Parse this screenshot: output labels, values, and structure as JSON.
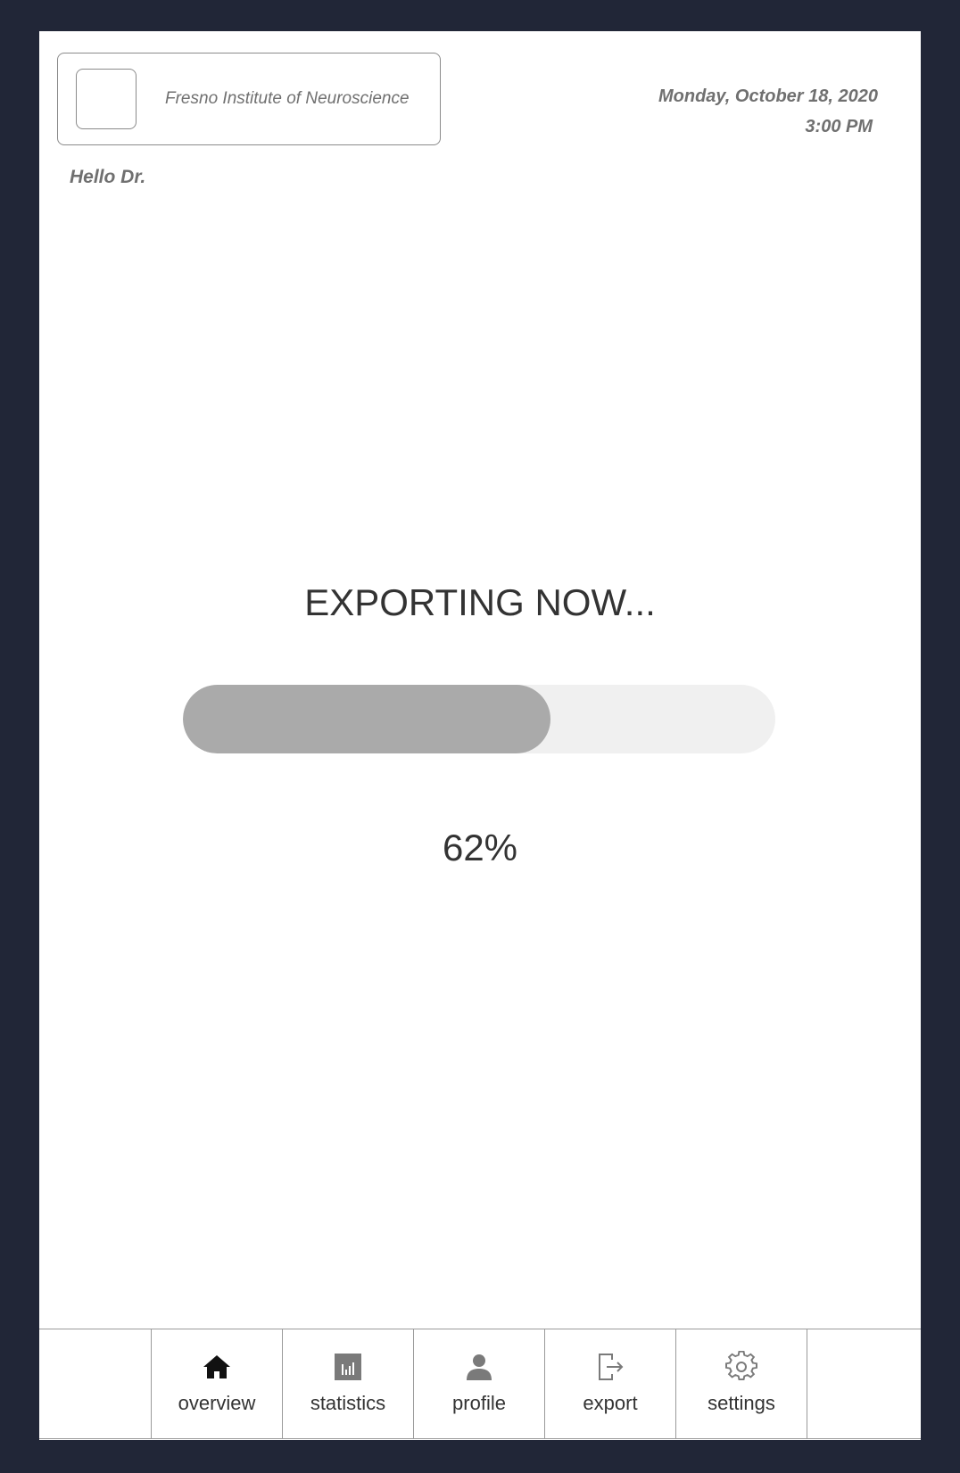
{
  "header": {
    "institution_name": "Fresno Institute of Neuroscience",
    "date": "Monday, October 18, 2020",
    "time": "3:00 PM",
    "greeting": "Hello Dr."
  },
  "export_status": {
    "title": "EXPORTING NOW...",
    "progress": 0.62,
    "percent_label": "62%"
  },
  "nav": {
    "items": [
      {
        "label": "overview",
        "icon": "home-icon"
      },
      {
        "label": "statistics",
        "icon": "bar-chart-icon"
      },
      {
        "label": "profile",
        "icon": "user-icon"
      },
      {
        "label": "export",
        "icon": "export-icon"
      },
      {
        "label": "settings",
        "icon": "gear-icon"
      }
    ]
  },
  "colors": {
    "frame": "#212637",
    "progress_fill": "#aaaaaa",
    "progress_track": "#f0f0f0",
    "text_dark": "#333333",
    "text_muted": "#707070"
  }
}
